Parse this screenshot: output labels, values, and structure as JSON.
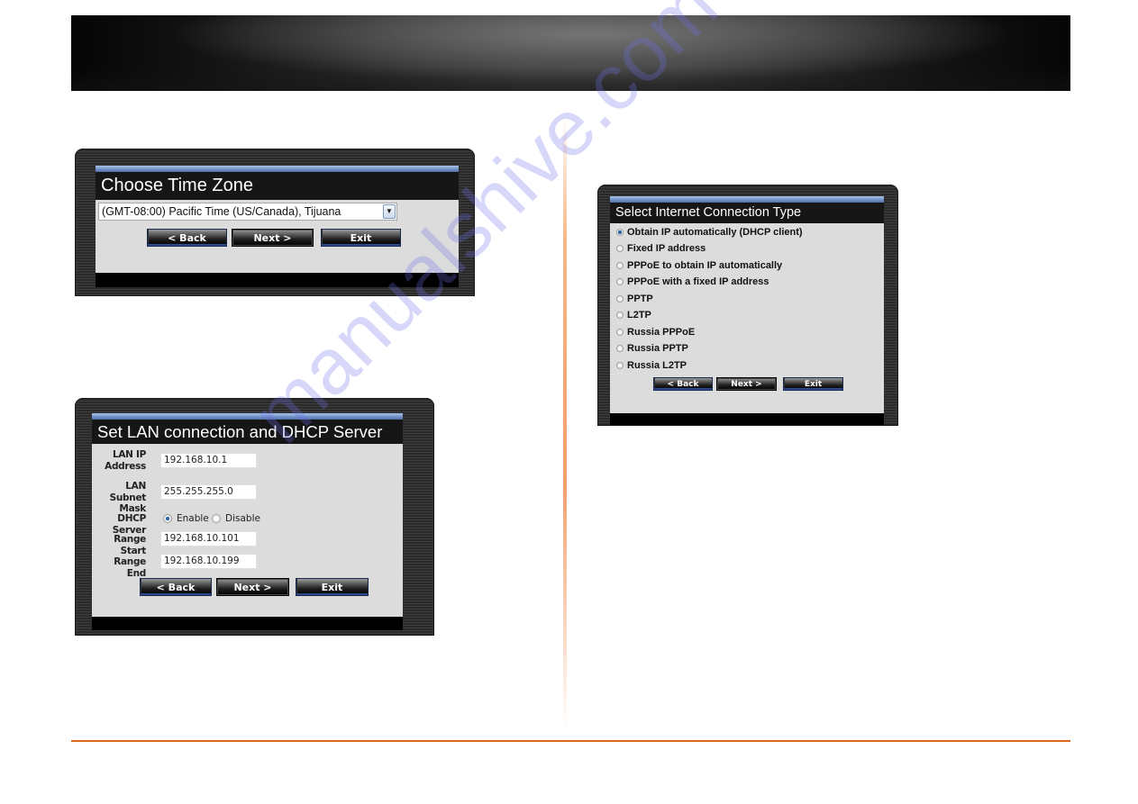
{
  "watermark": "manualshive.com",
  "timezone_panel": {
    "title": "Choose Time Zone",
    "selected_timezone": "(GMT-08:00) Pacific Time (US/Canada), Tijuana",
    "buttons": {
      "back": "< Back",
      "next": "Next >",
      "exit": "Exit"
    }
  },
  "lan_panel": {
    "title": "Set LAN connection and DHCP Server",
    "fields": {
      "lan_ip_label_1": "LAN IP",
      "lan_ip_label_2": "Address",
      "lan_ip_value": "192.168.10.1",
      "subnet_label_1": "LAN Subnet",
      "subnet_label_2": "Mask",
      "subnet_value": "255.255.255.0",
      "dhcp_label": "DHCP Server",
      "dhcp_enable": "Enable",
      "dhcp_disable": "Disable",
      "dhcp_selected": "Enable",
      "range_start_label": "Range Start",
      "range_start_value": "192.168.10.101",
      "range_end_label": "Range End",
      "range_end_value": "192.168.10.199"
    },
    "buttons": {
      "back": "< Back",
      "next": "Next >",
      "exit": "Exit"
    }
  },
  "internet_panel": {
    "title": "Select Internet Connection Type",
    "selected": "Obtain IP automatically (DHCP client)",
    "options": [
      "Obtain IP automatically (DHCP client)",
      "Fixed IP address",
      "PPPoE to obtain IP automatically",
      "PPPoE with a fixed IP address",
      "PPTP",
      "L2TP",
      "Russia PPPoE",
      "Russia PPTP",
      "Russia L2TP"
    ],
    "buttons": {
      "back": "< Back",
      "next": "Next >",
      "exit": "Exit"
    }
  },
  "colors": {
    "accent_line": "#e0661e",
    "title_bar_blue": "#6f8fc4",
    "content_bg": "#dcdcdc",
    "radio_selected": "#1f5fa5"
  }
}
